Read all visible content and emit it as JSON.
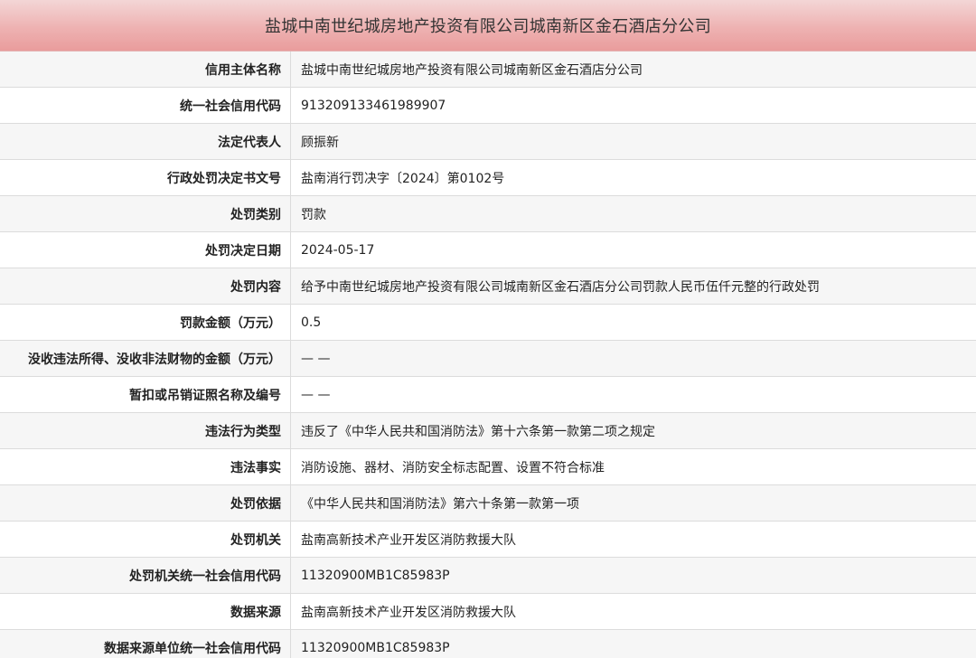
{
  "header": {
    "title": "盐城中南世纪城房地产投资有限公司城南新区金石酒店分公司"
  },
  "rows": [
    {
      "label": "信用主体名称",
      "value": "盐城中南世纪城房地产投资有限公司城南新区金石酒店分公司"
    },
    {
      "label": "统一社会信用代码",
      "value": "913209133461989907"
    },
    {
      "label": "法定代表人",
      "value": "顾振新"
    },
    {
      "label": "行政处罚决定书文号",
      "value": "盐南消行罚决字〔2024〕第0102号"
    },
    {
      "label": "处罚类别",
      "value": "罚款"
    },
    {
      "label": "处罚决定日期",
      "value": "2024-05-17"
    },
    {
      "label": "处罚内容",
      "value": "给予中南世纪城房地产投资有限公司城南新区金石酒店分公司罚款人民币伍仟元整的行政处罚"
    },
    {
      "label": "罚款金额（万元）",
      "value": "0.5"
    },
    {
      "label": "没收违法所得、没收非法财物的金额（万元）",
      "value": "— —"
    },
    {
      "label": "暂扣或吊销证照名称及编号",
      "value": "— —"
    },
    {
      "label": "违法行为类型",
      "value": "违反了《中华人民共和国消防法》第十六条第一款第二项之规定"
    },
    {
      "label": "违法事实",
      "value": "消防设施、器材、消防安全标志配置、设置不符合标准"
    },
    {
      "label": "处罚依据",
      "value": "《中华人民共和国消防法》第六十条第一款第一项"
    },
    {
      "label": "处罚机关",
      "value": "盐南高新技术产业开发区消防救援大队"
    },
    {
      "label": "处罚机关统一社会信用代码",
      "value": "11320900MB1C85983P"
    },
    {
      "label": "数据来源",
      "value": "盐南高新技术产业开发区消防救援大队"
    },
    {
      "label": "数据来源单位统一社会信用代码",
      "value": "11320900MB1C85983P"
    }
  ]
}
